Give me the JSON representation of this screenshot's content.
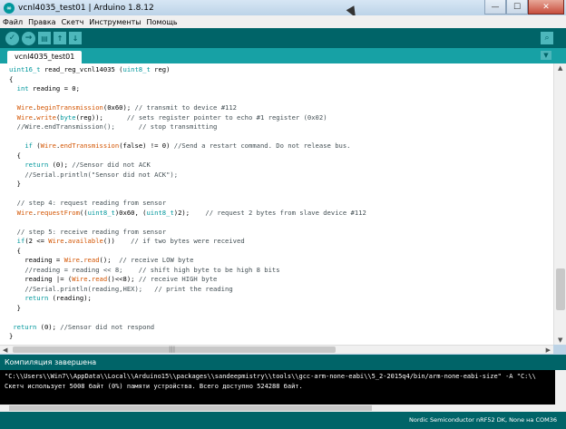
{
  "window": {
    "title": "vcnl4035_test01 | Arduino 1.8.12",
    "controls": {
      "minimize": "—",
      "maximize": "☐",
      "close": "✕"
    }
  },
  "menu": [
    "Файл",
    "Правка",
    "Скетч",
    "Инструменты",
    "Помощь"
  ],
  "toolbar": {
    "verify": "✓",
    "upload": "→",
    "new": "▤",
    "open": "↑",
    "save": "↓",
    "serial_monitor": "⌕"
  },
  "tabs": [
    {
      "label": "vcnl4035_test01"
    }
  ],
  "tab_menu_icon": "▼",
  "editor": {
    "lines": [
      "uint16_t read_reg_vcnl14035 (uint8_t reg)",
      "{",
      "  int reading = 0;",
      "",
      "  Wire.beginTransmission(0x60); // transmit to device #112",
      "  Wire.write(byte(reg));      // sets register pointer to echo #1 register (0x02)",
      "  //Wire.endTransmission();      // stop transmitting",
      "",
      "    if (Wire.endTransmission(false) != 0) //Send a restart command. Do not release bus.",
      "  {",
      "    return (0); //Sensor did not ACK",
      "    //Serial.println(\"Sensor did not ACK\");",
      "  }",
      "",
      "  // step 4: request reading from sensor",
      "  Wire.requestFrom((uint8_t)0x60, (uint8_t)2);    // request 2 bytes from slave device #112",
      "",
      "  // step 5: receive reading from sensor",
      "  if(2 <= Wire.available())    // if two bytes were received",
      "  {",
      "    reading = Wire.read();  // receive LOW byte",
      "    //reading = reading << 8;    // shift high byte to be high 8 bits",
      "    reading |= (Wire.read()<<8); // receive HIGH byte",
      "    //Serial.println(reading,HEX);   // print the reading",
      "    return (reading);",
      "  }",
      "",
      " return (0); //Sensor did not respond",
      "}"
    ]
  },
  "message_bar": "Компиляция завершена",
  "console": {
    "lines": [
      "\"C:\\\\Users\\\\Win7\\\\AppData\\\\Local\\\\Arduino15\\\\packages\\\\sandeepmistry\\\\tools\\\\gcc-arm-none-eabi\\\\5_2-2015q4/bin/arm-none-eabi-size\" -A \"C:\\\\",
      "Скетч использует 5008 байт (0%) памяти устройства. Всего доступно 524288 байт."
    ]
  },
  "footer": "Nordic Semiconductor nRF52 DK, None на COM36"
}
